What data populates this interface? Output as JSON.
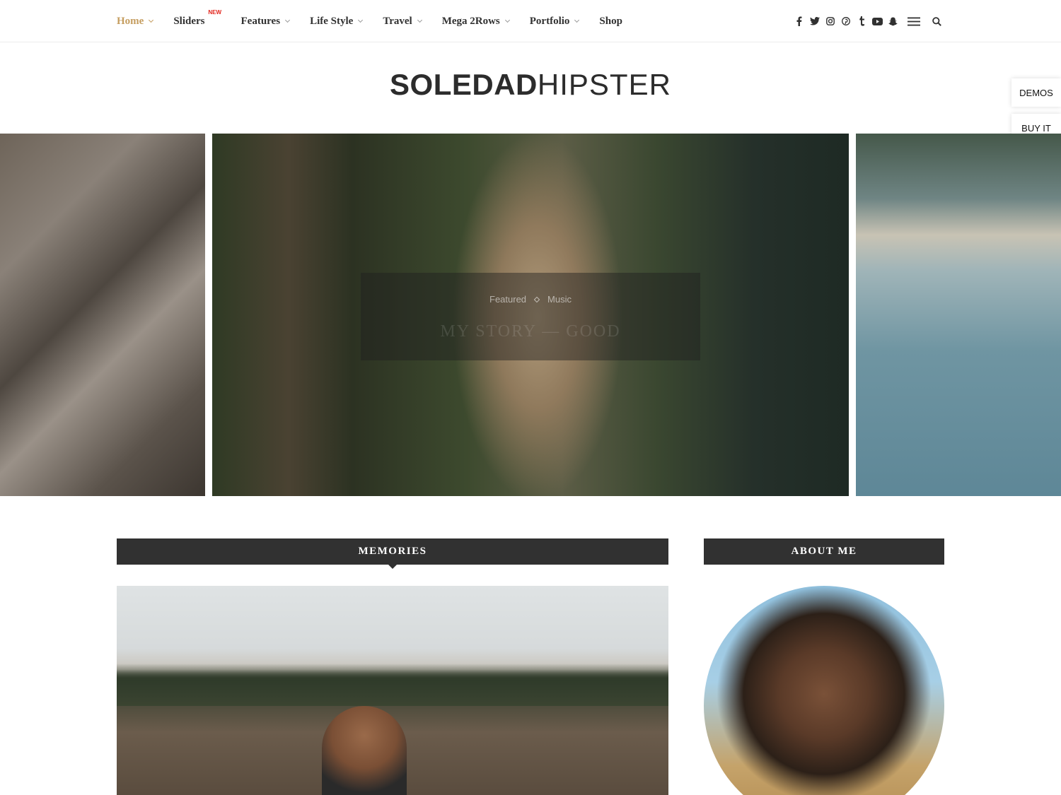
{
  "nav": {
    "items": [
      {
        "label": "Home",
        "has_dropdown": true,
        "active": true
      },
      {
        "label": "Sliders",
        "has_dropdown": false,
        "badge": "NEW"
      },
      {
        "label": "Features",
        "has_dropdown": true
      },
      {
        "label": "Life Style",
        "has_dropdown": true
      },
      {
        "label": "Travel",
        "has_dropdown": true
      },
      {
        "label": "Mega 2Rows",
        "has_dropdown": true
      },
      {
        "label": "Portfolio",
        "has_dropdown": true
      },
      {
        "label": "Shop",
        "has_dropdown": false
      }
    ],
    "social_icons": [
      "facebook-icon",
      "twitter-icon",
      "instagram-icon",
      "pinterest-icon",
      "tumblr-icon",
      "youtube-icon",
      "snapchat-icon"
    ],
    "menu_icon": "hamburger-icon",
    "search_icon": "search-icon"
  },
  "logo": {
    "part1": "SOLEDAD",
    "part2": "HIPSTER"
  },
  "side_buttons": {
    "demos": "DEMOS",
    "buy": "BUY IT"
  },
  "slider": {
    "caption": {
      "categories": [
        "Featured",
        "Music"
      ],
      "title": "My Story — Good"
    }
  },
  "sections": {
    "main_heading": "MEMORIES",
    "sidebar_heading": "ABOUT ME"
  },
  "colors": {
    "accent": "#c59d5f",
    "dark": "#313131",
    "badge": "#e2231a"
  }
}
